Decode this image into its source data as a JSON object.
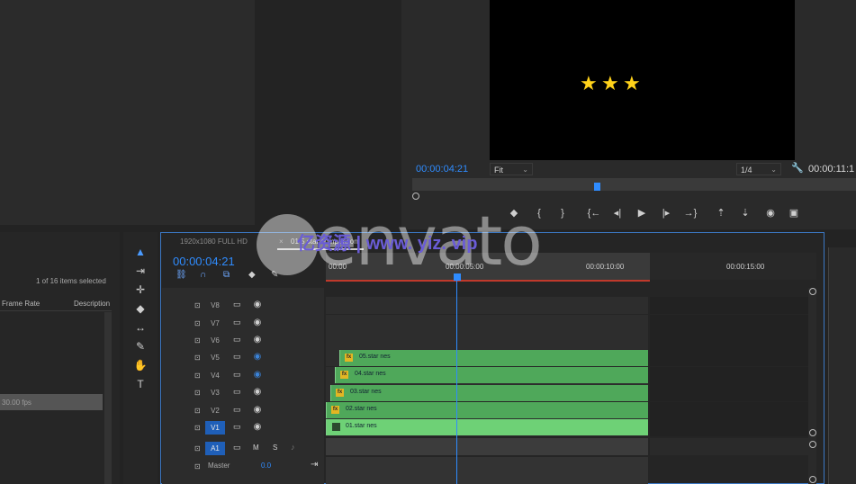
{
  "program_monitor": {
    "timecode": "00:00:04:21",
    "zoom": "Fit",
    "resolution": "1/4",
    "duration_timecode": "00:00:11:1",
    "stars": [
      "★",
      "★",
      "★"
    ],
    "star_color": "#ffd21a",
    "icons": {
      "marker": "◆",
      "in": "{",
      "out": "}",
      "go_in": "{←",
      "step_back": "◂|",
      "play": "▶",
      "step_fwd": "|▸",
      "go_out": "→}",
      "lift": "⇡",
      "extract": "⇣",
      "export_frame": "◉",
      "button_editor": "▣",
      "wrench": "🔧"
    }
  },
  "project_panel": {
    "items_selected": "1 of 16 items selected",
    "col_frame_rate": "Frame Rate",
    "col_description": "Description",
    "selected_fps": "30.00 fps"
  },
  "tools": [
    "▲",
    "⇥",
    "✛",
    "◆",
    "↔",
    "✎",
    "✋",
    "T"
  ],
  "timeline": {
    "tab_1": "1920x1080 FULL HD",
    "tab_close": "×",
    "tab_2": "01 5 star comparison",
    "timecode": "00:00:04:21",
    "ruler_labels": [
      "00:00",
      "00:00:05:00",
      "00:00:10:00",
      "00:00:15:00"
    ],
    "playhead_color": "#2f8cff",
    "tracks": [
      {
        "name": "V8",
        "eye_off": false
      },
      {
        "name": "V7",
        "eye_off": false
      },
      {
        "name": "V6",
        "eye_off": false
      },
      {
        "name": "V5",
        "eye_off": true
      },
      {
        "name": "V4",
        "eye_off": true
      },
      {
        "name": "V3",
        "eye_off": false
      },
      {
        "name": "V2",
        "eye_off": false
      },
      {
        "name": "V1",
        "eye_off": false,
        "selected": true
      }
    ],
    "audio": {
      "name": "A1",
      "m": "M",
      "s": "S"
    },
    "master": {
      "label": "Master",
      "value": "0.0"
    },
    "clips": [
      {
        "name": "05.star nes",
        "fx": "fx"
      },
      {
        "name": "04.star nes",
        "fx": "fx"
      },
      {
        "name": "03.star nes",
        "fx": "fx"
      },
      {
        "name": "02.star nes",
        "fx": "fx"
      },
      {
        "name": "01.star nes",
        "fx": ""
      }
    ],
    "icons": {
      "lock": "🔒",
      "film": "▭",
      "eye": "👁",
      "mic": "🎙"
    }
  },
  "watermark": {
    "brand": "envato",
    "site": "亿资源 | www. yiz. vip"
  }
}
